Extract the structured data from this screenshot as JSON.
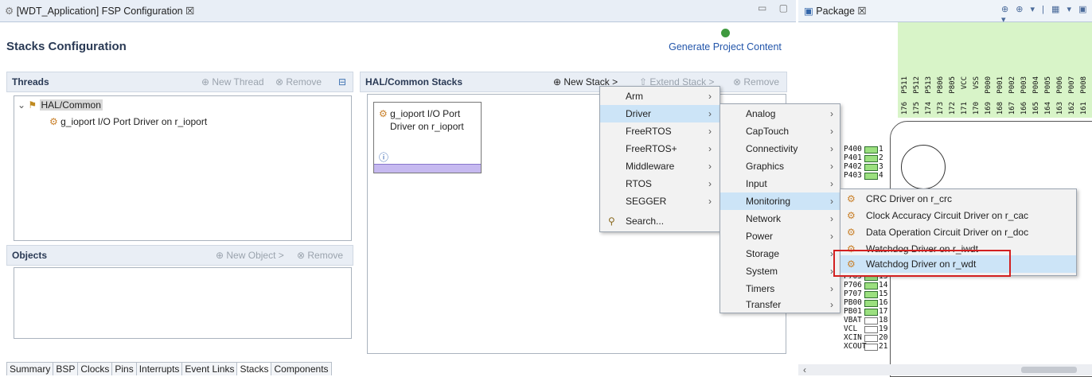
{
  "editor": {
    "tab_title": "[WDT_Application] FSP Configuration ☒"
  },
  "stacks": {
    "title": "Stacks Configuration",
    "generate_label": "Generate Project Content"
  },
  "threads": {
    "title": "Threads",
    "new_thread": "New Thread",
    "remove": "Remove",
    "tree": [
      {
        "label": "HAL/Common"
      },
      {
        "label": "g_ioport I/O Port Driver on r_ioport"
      }
    ]
  },
  "objects": {
    "title": "Objects",
    "new_object": "New Object >",
    "remove": "Remove"
  },
  "hal": {
    "title": "HAL/Common Stacks",
    "new_stack": "New Stack >",
    "extend_stack": "Extend Stack >",
    "remove": "Remove",
    "block_line1": "g_ioport I/O Port",
    "block_line2": "Driver on r_ioport",
    "info": "ⓘ"
  },
  "bottom_tabs": [
    "Summary",
    "BSP",
    "Clocks",
    "Pins",
    "Interrupts",
    "Event Links",
    "Stacks",
    "Components"
  ],
  "menu1": [
    "Arm",
    "Driver",
    "FreeRTOS",
    "FreeRTOS+",
    "Middleware",
    "RTOS",
    "SEGGER",
    "Search..."
  ],
  "menu2": [
    "Analog",
    "CapTouch",
    "Connectivity",
    "Graphics",
    "Input",
    "Monitoring",
    "Network",
    "Power",
    "Storage",
    "System",
    "Timers",
    "Transfer"
  ],
  "menu3": [
    "CRC Driver on r_crc",
    "Clock Accuracy Circuit Driver on r_cac",
    "Data Operation Circuit Driver on r_doc",
    "Watchdog Driver on r_iwdt",
    "Watchdog Driver on r_wdt"
  ],
  "package": {
    "tab_title": "Package ☒",
    "tools": "⊕ ⊕ ▾ | ▦ ▾ ▣ ▾",
    "top_pins": [
      "P511",
      "P512",
      "P513",
      "P806",
      "P805",
      "VCC",
      "VSS",
      "P000",
      "P001",
      "P002",
      "P003",
      "P004",
      "P005",
      "P006",
      "P007",
      "P008"
    ],
    "top_nums": [
      "176",
      "175",
      "174",
      "173",
      "172",
      "171",
      "170",
      "169",
      "168",
      "167",
      "166",
      "165",
      "164",
      "163",
      "162",
      "161"
    ],
    "left_pins": [
      {
        "name": "P400",
        "num": "1"
      },
      {
        "name": "P401",
        "num": "2"
      },
      {
        "name": "P402",
        "num": "3"
      },
      {
        "name": "P403",
        "num": "4"
      },
      {
        "name": "P705",
        "num": "13"
      },
      {
        "name": "P706",
        "num": "14"
      },
      {
        "name": "P707",
        "num": "15"
      },
      {
        "name": "PB00",
        "num": "16"
      },
      {
        "name": "PB01",
        "num": "17"
      },
      {
        "name": "VBAT",
        "num": "18"
      },
      {
        "name": "VCL",
        "num": "19"
      },
      {
        "name": "XCIN",
        "num": "20"
      },
      {
        "name": "XCOUT",
        "num": "21"
      }
    ]
  }
}
